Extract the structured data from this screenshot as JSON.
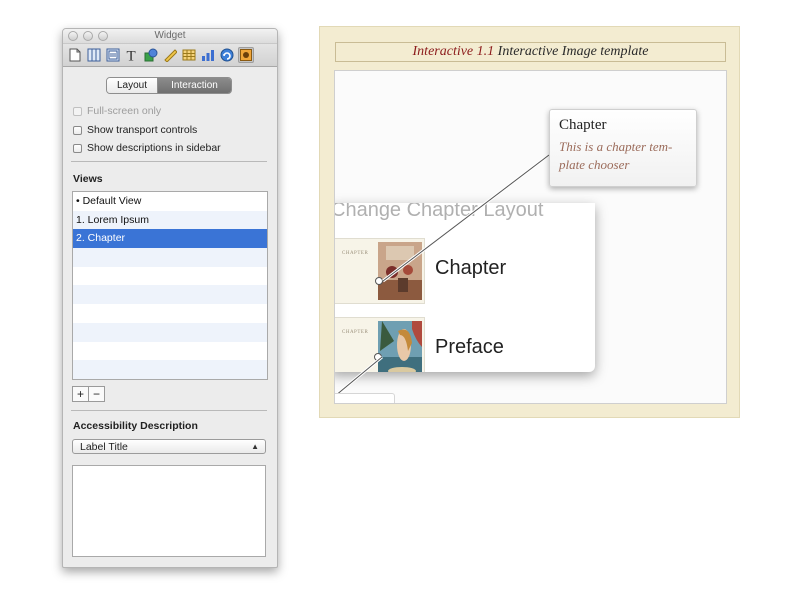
{
  "inspector": {
    "title": "Widget",
    "toolbar": [
      "document-icon",
      "columns-icon",
      "metrics-icon",
      "text-icon",
      "graphic-icon",
      "ruler-icon",
      "table-icon",
      "chart-icon",
      "link-icon",
      "widget-icon"
    ],
    "tabs": {
      "layout": "Layout",
      "interaction": "Interaction"
    },
    "options": {
      "fullscreen": "Full-screen only",
      "transport": "Show transport controls",
      "descriptions": "Show descriptions in sidebar"
    },
    "views_label": "Views",
    "views": [
      "• Default View",
      "1. Lorem Ipsum",
      "2. Chapter"
    ],
    "selected_view": "2. Chapter",
    "add_label": "+",
    "remove_label": "−",
    "accessibility_label": "Accessibility Description",
    "accessibility_value": "Label Title",
    "description_text": ""
  },
  "preview": {
    "title_number": "Interactive 1.1",
    "title_text": " Interactive Image template",
    "chooser_header": "Change Chapter Layout",
    "options": [
      {
        "label": "Chapter",
        "thumb_caption": "CHAPTER"
      },
      {
        "label": "Preface",
        "thumb_caption": "CHAPTER"
      }
    ],
    "callout": {
      "title": "Chapter",
      "description": "This is a chapter tem-plate chooser"
    }
  },
  "colors": {
    "accent": "#3a74d6",
    "title_number": "#8c1b1b",
    "widget_bg": "#f3ecd1",
    "callout_desc": "#9b6b5a"
  }
}
